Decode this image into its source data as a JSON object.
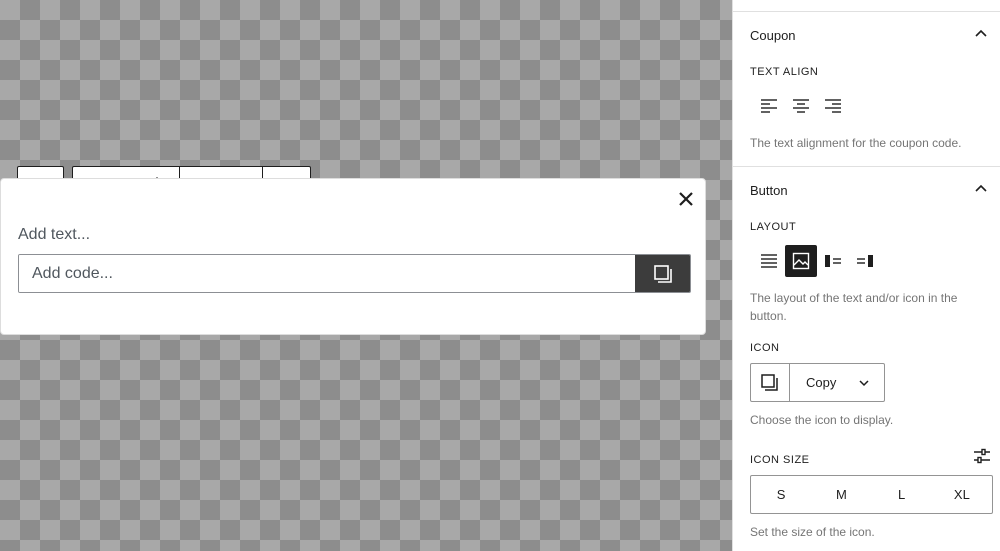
{
  "block": {
    "text_placeholder": "Add text...",
    "code_placeholder": "Add code..."
  },
  "sidebar": {
    "coupon_panel": {
      "title": "Coupon",
      "text_align_label": "TEXT ALIGN",
      "text_align_help": "The text alignment for the coupon code."
    },
    "button_panel": {
      "title": "Button",
      "layout_label": "LAYOUT",
      "layout_help": "The layout of the text and/or icon in the button.",
      "icon_label": "ICON",
      "icon_selected": "Copy",
      "icon_help": "Choose the icon to display.",
      "icon_size_label": "ICON SIZE",
      "icon_sizes": [
        "S",
        "M",
        "L",
        "XL"
      ],
      "icon_size_help": "Set the size of the icon."
    }
  },
  "colors": {
    "dark": "#1e1e1e",
    "copy_button_bg": "#3c3c3c",
    "help_text": "#757575",
    "divider": "#e0e0e0"
  }
}
